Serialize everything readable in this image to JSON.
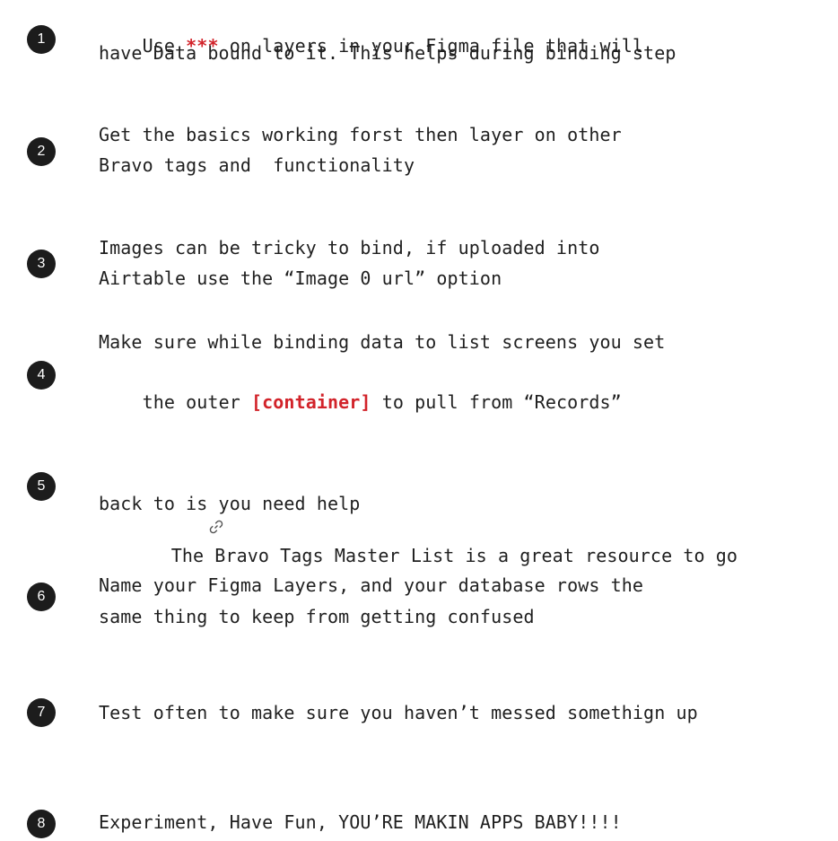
{
  "tips": [
    {
      "number": "1",
      "line1_before": "Use ",
      "line1_highlight": "***",
      "line1_after": " on layers in your Figma file that will",
      "line2": "have Data bound to it. This helps during binding step"
    },
    {
      "number": "2",
      "line1": "Get the basics working forst then layer on other",
      "line2": "Bravo tags and  functionality"
    },
    {
      "number": "3",
      "line1": "Images can be tricky to bind, if uploaded into",
      "line2": "Airtable use the “Image 0 url” option"
    },
    {
      "number": "4",
      "line1": "Make sure while binding data to list screens you set",
      "line2_before": "the outer ",
      "line2_highlight": "[container]",
      "line2_after": " to pull from “Records”"
    },
    {
      "number": "5",
      "link_icon": "link-icon",
      "line1": " The Bravo Tags Master List is a great resource to go",
      "line2": "back to is you need help"
    },
    {
      "number": "6",
      "line1": "Name your Figma Layers, and your database rows the",
      "line2": "same thing to keep from getting confused"
    },
    {
      "number": "7",
      "line1": "Test often to make sure you haven’t messed somethign up"
    },
    {
      "number": "8",
      "line1": "Experiment, Have Fun, YOU’RE MAKIN APPS BABY!!!!"
    }
  ],
  "colors": {
    "highlight": "#d2232a",
    "badge": "#1c1c1c",
    "text": "#1f1f1f"
  }
}
